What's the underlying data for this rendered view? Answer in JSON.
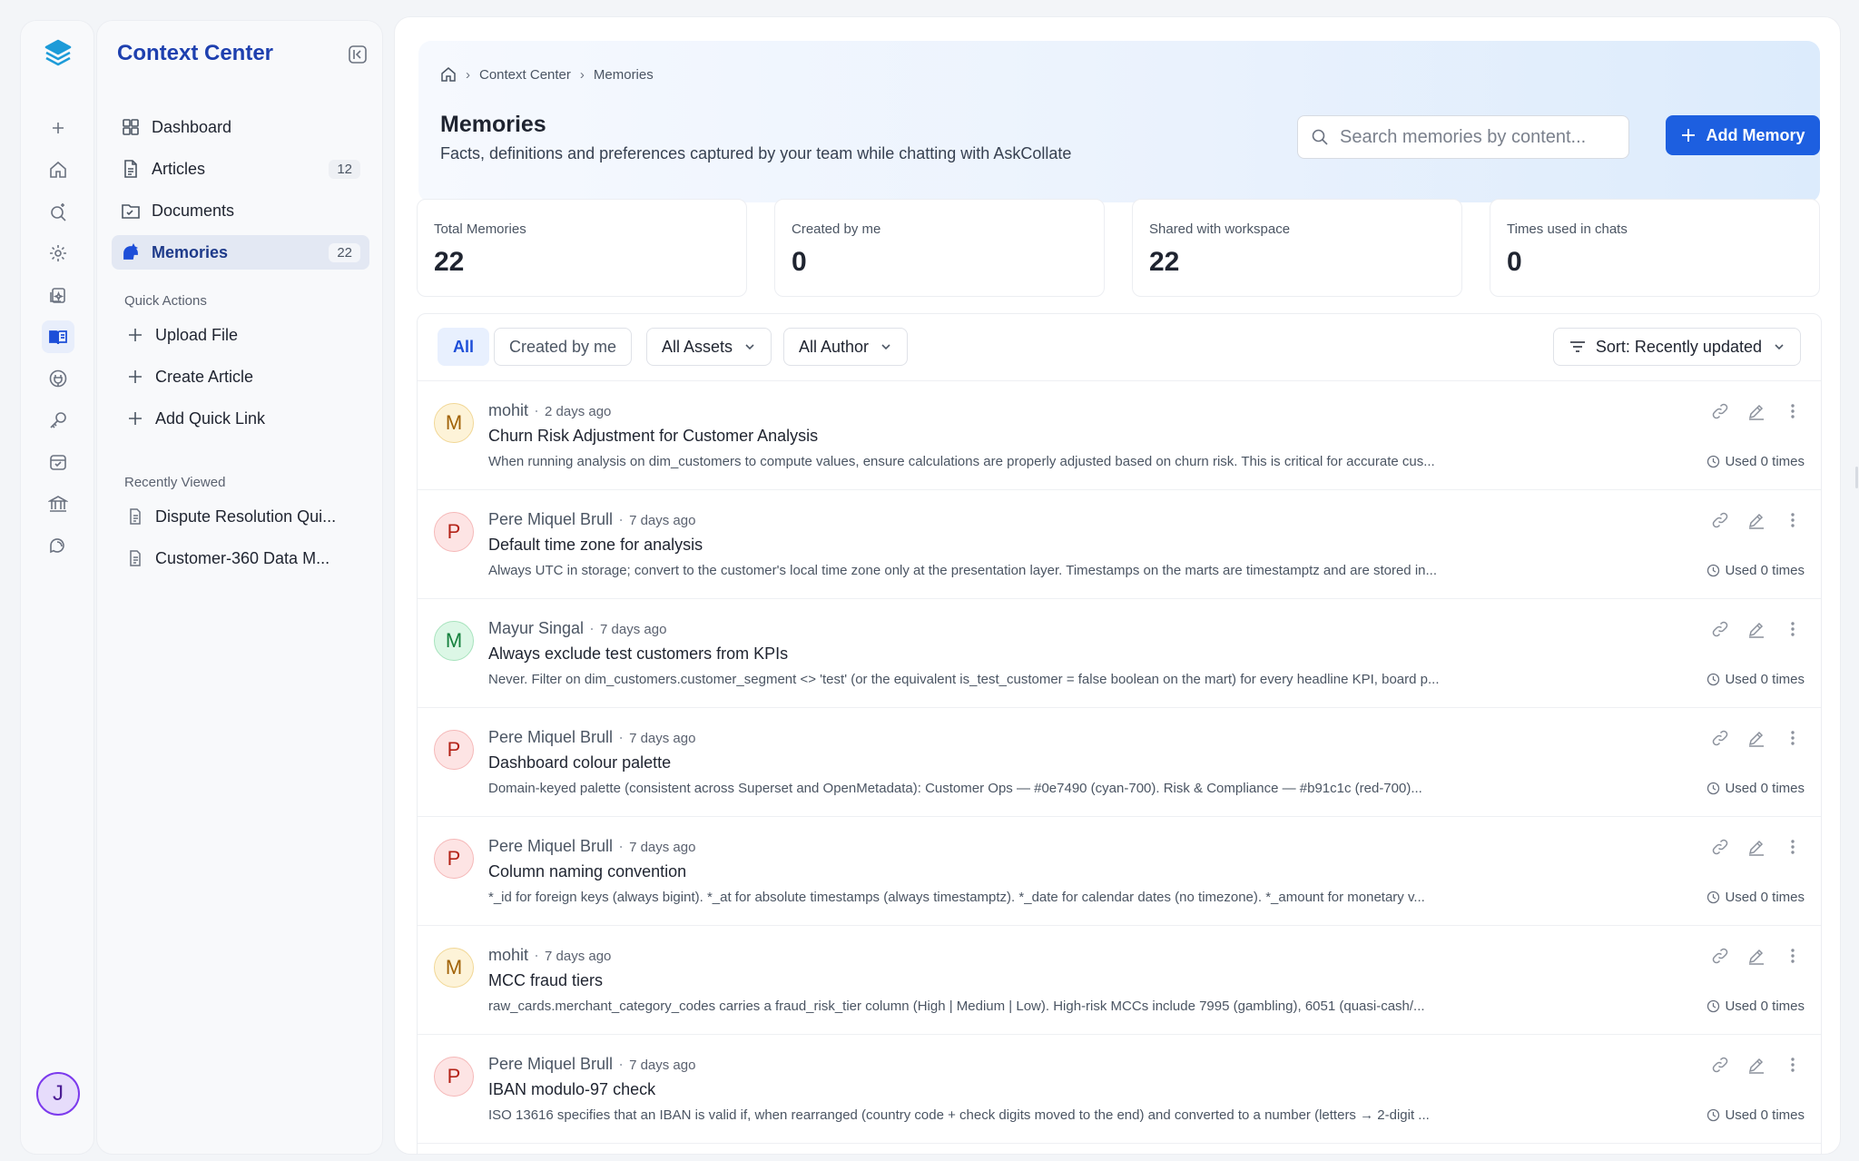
{
  "sidebar": {
    "title": "Context Center",
    "nav": [
      {
        "label": "Dashboard",
        "icon": "grid-icon",
        "badge": ""
      },
      {
        "label": "Articles",
        "icon": "file-text-icon",
        "badge": "12"
      },
      {
        "label": "Documents",
        "icon": "folder-icon",
        "badge": ""
      },
      {
        "label": "Memories",
        "icon": "memory-icon",
        "badge": "22",
        "active": true
      }
    ],
    "quick_actions_label": "Quick Actions",
    "quick_actions": [
      "Upload File",
      "Create Article",
      "Add Quick Link"
    ],
    "recently_viewed_label": "Recently Viewed",
    "recently_viewed": [
      "Dispute Resolution Qui...",
      "Customer-360 Data M..."
    ]
  },
  "rail": {
    "avatar_initial": "J",
    "icons": [
      "plus-icon",
      "home-icon",
      "search-sparkle-icon",
      "settings-icon",
      "sparkle-file-icon",
      "book-icon",
      "plug-icon",
      "key-icon",
      "calendar-icon",
      "bank-icon",
      "chat-icon"
    ]
  },
  "breadcrumb": {
    "home": "home-icon",
    "items": [
      "Context Center",
      "Memories"
    ]
  },
  "page": {
    "title": "Memories",
    "subtitle": "Facts, definitions and preferences captured by your team while chatting with AskCollate",
    "search_placeholder": "Search memories by content...",
    "add_button": "Add Memory"
  },
  "stats": [
    {
      "label": "Total Memories",
      "value": "22"
    },
    {
      "label": "Created by me",
      "value": "0"
    },
    {
      "label": "Shared with workspace",
      "value": "22"
    },
    {
      "label": "Times used in chats",
      "value": "0"
    }
  ],
  "filters": {
    "all": "All",
    "created_by_me": "Created by me",
    "assets": "All Assets",
    "author": "All Author",
    "sort_prefix": "Sort:",
    "sort_value": "Recently updated"
  },
  "memories": [
    {
      "author": "mohit",
      "initial": "M",
      "time": "2 days ago",
      "title": "Churn Risk Adjustment for Customer Analysis",
      "desc": "When running analysis on dim_customers to compute values, ensure calculations are properly adjusted based on churn risk. This is critical for accurate cus...",
      "used": "Used 0 times",
      "color": "amber"
    },
    {
      "author": "Pere Miquel Brull",
      "initial": "P",
      "time": "7 days ago",
      "title": "Default time zone for analysis",
      "desc": "Always UTC in storage; convert to the customer's local time zone only at the presentation layer. Timestamps on the marts are timestamptz and are stored in...",
      "used": "Used 0 times",
      "color": "red"
    },
    {
      "author": "Mayur Singal",
      "initial": "M",
      "time": "7 days ago",
      "title": "Always exclude test customers from KPIs",
      "desc": "Never. Filter on dim_customers.customer_segment <> 'test' (or the equivalent is_test_customer = false boolean on the mart) for every headline KPI, board p...",
      "used": "Used 0 times",
      "color": "green"
    },
    {
      "author": "Pere Miquel Brull",
      "initial": "P",
      "time": "7 days ago",
      "title": "Dashboard colour palette",
      "desc": "Domain-keyed palette (consistent across Superset and OpenMetadata): Customer Ops — #0e7490 (cyan-700). Risk & Compliance — #b91c1c (red-700)...",
      "used": "Used 0 times",
      "color": "red"
    },
    {
      "author": "Pere Miquel Brull",
      "initial": "P",
      "time": "7 days ago",
      "title": "Column naming convention",
      "desc": "*_id for foreign keys (always bigint). *_at for absolute timestamps (always timestamptz). *_date for calendar dates (no timezone). *_amount for monetary v...",
      "used": "Used 0 times",
      "color": "red"
    },
    {
      "author": "mohit",
      "initial": "M",
      "time": "7 days ago",
      "title": "MCC fraud tiers",
      "desc": "raw_cards.merchant_category_codes carries a fraud_risk_tier column (High | Medium | Low). High-risk MCCs include 7995 (gambling), 6051 (quasi-cash/...",
      "used": "Used 0 times",
      "color": "amber"
    },
    {
      "author": "Pere Miquel Brull",
      "initial": "P",
      "time": "7 days ago",
      "title": "IBAN modulo-97 check",
      "desc": "ISO 13616 specifies that an IBAN is valid if, when rearranged (country code + check digits moved to the end) and converted to a number (letters → 2-digit ...",
      "used": "Used 0 times",
      "color": "red"
    }
  ],
  "colors": {
    "accent": "#1d5fe0",
    "amber_bg": "#fdf3d8",
    "amber_fg": "#a16207",
    "amber_border": "#f1d796",
    "red_bg": "#fde4e4",
    "red_fg": "#b42318",
    "red_border": "#f5b8b8",
    "green_bg": "#dcf7e6",
    "green_fg": "#15803d",
    "green_border": "#a7e3bd"
  }
}
